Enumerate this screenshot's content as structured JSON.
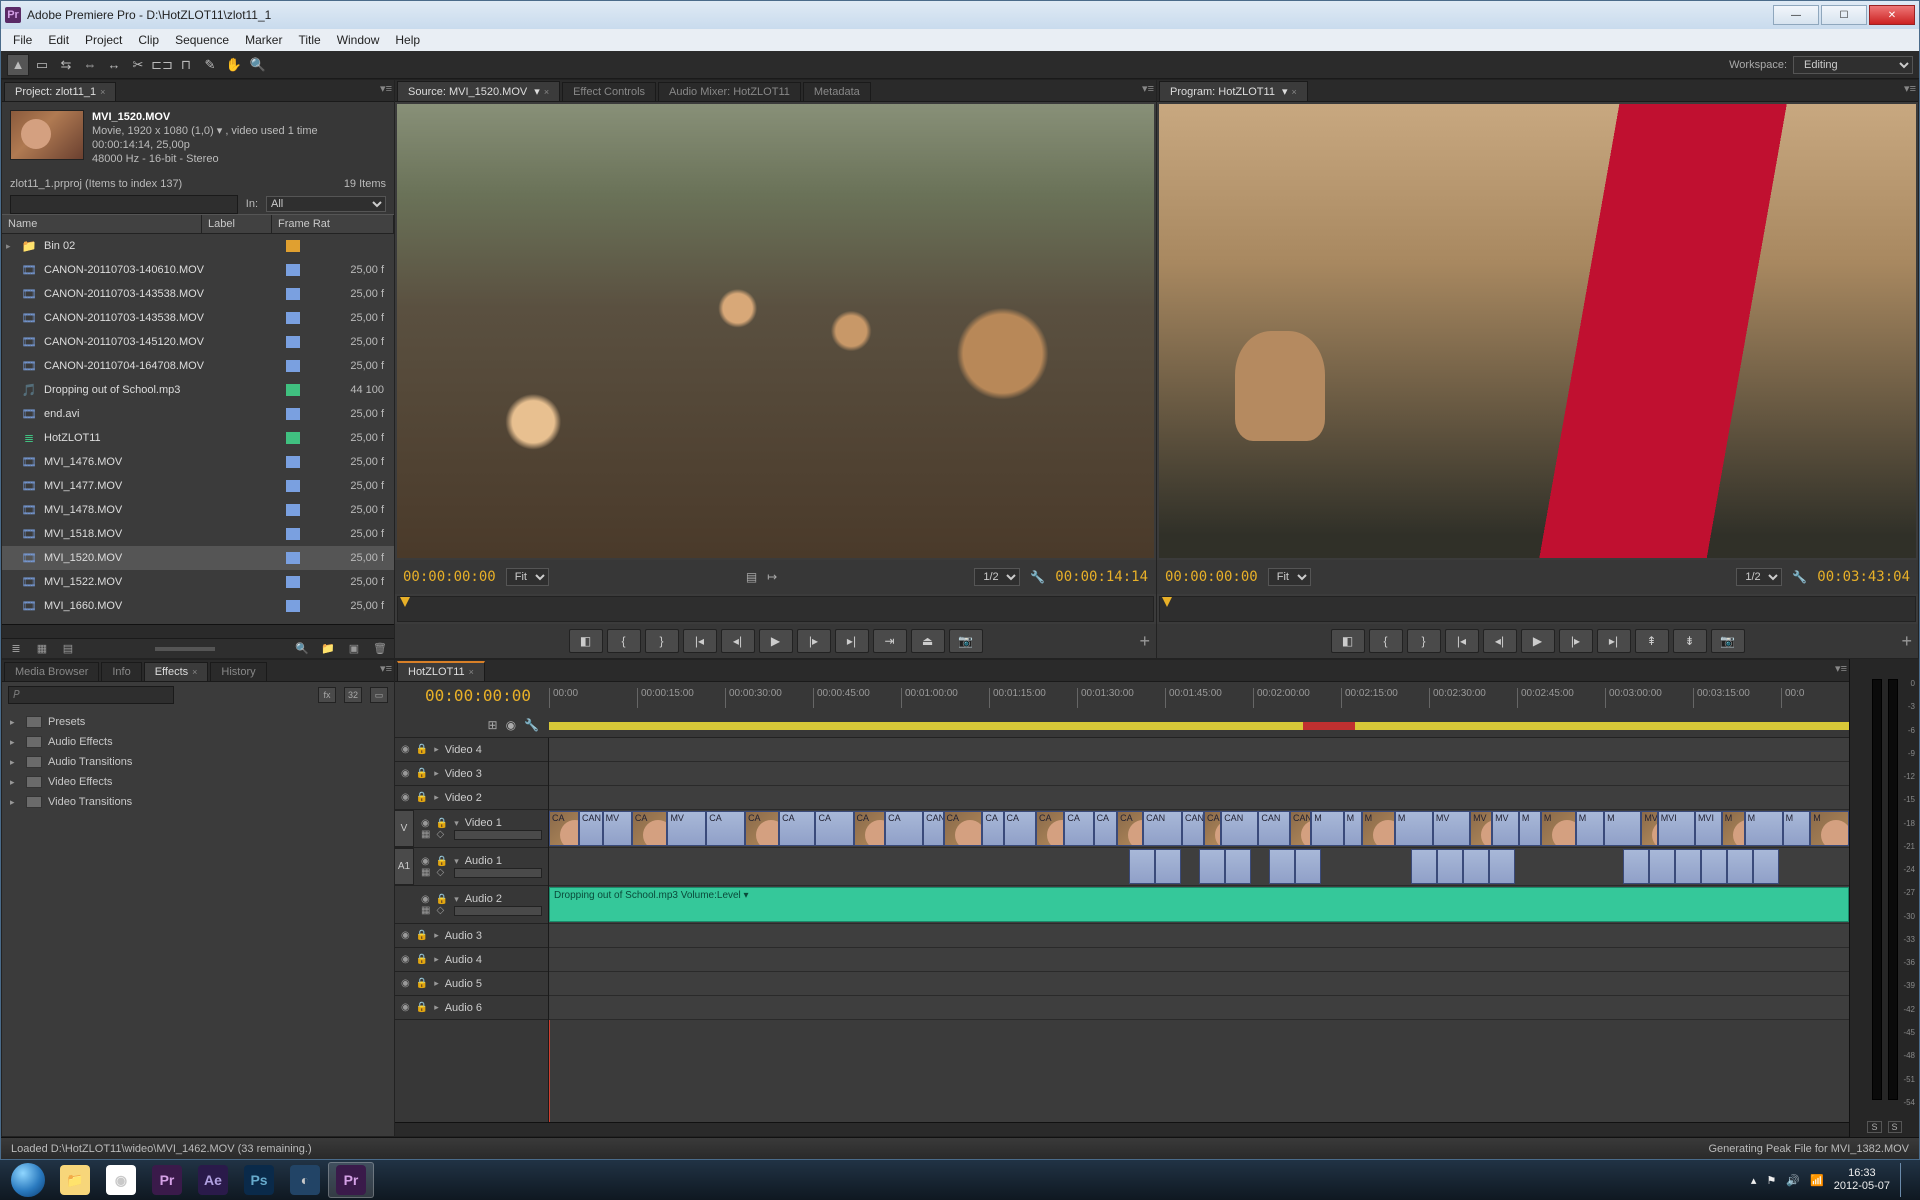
{
  "title": "Adobe Premiere Pro - D:\\HotZLOT11\\zlot11_1",
  "menus": [
    "File",
    "Edit",
    "Project",
    "Clip",
    "Sequence",
    "Marker",
    "Title",
    "Window",
    "Help"
  ],
  "workspace": {
    "label": "Workspace:",
    "value": "Editing"
  },
  "project": {
    "tab": "Project: zlot11_1",
    "clipName": "MVI_1520.MOV",
    "clipMeta1": "Movie, 1920 x 1080 (1,0) ▾ , video used 1 time",
    "clipMeta2": "00:00:14:14, 25,00p",
    "clipMeta3": "48000 Hz - 16-bit - Stereo",
    "path": "zlot11_1.prproj  (Items to index 137)",
    "count": "19 Items",
    "inLabel": "In:",
    "inValue": "All",
    "cols": {
      "name": "Name",
      "label": "Label",
      "rate": "Frame Rat"
    },
    "items": [
      {
        "ico": "📁",
        "name": "Bin 02",
        "lbl": "#e0a030",
        "rate": ""
      },
      {
        "ico": "🎞",
        "name": "CANON-20110703-140610.MOV",
        "lbl": "#7aa0e0",
        "rate": "25,00 f"
      },
      {
        "ico": "🎞",
        "name": "CANON-20110703-143538.MOV",
        "lbl": "#7aa0e0",
        "rate": "25,00 f"
      },
      {
        "ico": "🎞",
        "name": "CANON-20110703-143538.MOV",
        "lbl": "#7aa0e0",
        "rate": "25,00 f"
      },
      {
        "ico": "🎞",
        "name": "CANON-20110703-145120.MOV",
        "lbl": "#7aa0e0",
        "rate": "25,00 f"
      },
      {
        "ico": "🎞",
        "name": "CANON-20110704-164708.MOV",
        "lbl": "#7aa0e0",
        "rate": "25,00 f"
      },
      {
        "ico": "🎵",
        "name": "Dropping out of School.mp3",
        "lbl": "#40c080",
        "rate": "44 100"
      },
      {
        "ico": "🎞",
        "name": "end.avi",
        "lbl": "#7aa0e0",
        "rate": "25,00 f"
      },
      {
        "ico": "≣",
        "name": "HotZLOT11",
        "lbl": "#40c080",
        "rate": "25,00 f"
      },
      {
        "ico": "🎞",
        "name": "MVI_1476.MOV",
        "lbl": "#7aa0e0",
        "rate": "25,00 f"
      },
      {
        "ico": "🎞",
        "name": "MVI_1477.MOV",
        "lbl": "#7aa0e0",
        "rate": "25,00 f"
      },
      {
        "ico": "🎞",
        "name": "MVI_1478.MOV",
        "lbl": "#7aa0e0",
        "rate": "25,00 f"
      },
      {
        "ico": "🎞",
        "name": "MVI_1518.MOV",
        "lbl": "#7aa0e0",
        "rate": "25,00 f"
      },
      {
        "ico": "🎞",
        "name": "MVI_1520.MOV",
        "lbl": "#7aa0e0",
        "rate": "25,00 f",
        "sel": true
      },
      {
        "ico": "🎞",
        "name": "MVI_1522.MOV",
        "lbl": "#7aa0e0",
        "rate": "25,00 f"
      },
      {
        "ico": "🎞",
        "name": "MVI_1660.MOV",
        "lbl": "#7aa0e0",
        "rate": "25,00 f"
      }
    ]
  },
  "source": {
    "tabs": [
      {
        "t": "Source: MVI_1520.MOV",
        "a": true
      },
      {
        "t": "Effect Controls"
      },
      {
        "t": "Audio Mixer: HotZLOT11"
      },
      {
        "t": "Metadata"
      }
    ],
    "tcLeft": "00:00:00:00",
    "fit": "Fit",
    "zoom": "1/2",
    "tcRight": "00:00:14:14"
  },
  "program": {
    "tab": "Program: HotZLOT11",
    "tcLeft": "00:00:00:00",
    "fit": "Fit",
    "zoom": "1/2",
    "tcRight": "00:03:43:04"
  },
  "lowerTabs": {
    "a": "Media Browser",
    "b": "Info",
    "c": "Effects",
    "d": "History"
  },
  "effectsTree": [
    "Presets",
    "Audio Effects",
    "Audio Transitions",
    "Video Effects",
    "Video Transitions"
  ],
  "timeline": {
    "tab": "HotZLOT11",
    "tc": "00:00:00:00",
    "ticks": [
      "00:00",
      "00:00:15:00",
      "00:00:30:00",
      "00:00:45:00",
      "00:01:00:00",
      "00:01:15:00",
      "00:01:30:00",
      "00:01:45:00",
      "00:02:00:00",
      "00:02:15:00",
      "00:02:30:00",
      "00:02:45:00",
      "00:03:00:00",
      "00:03:15:00",
      "00:0"
    ],
    "vtracks": [
      "Video 4",
      "Video 3",
      "Video 2",
      "Video 1"
    ],
    "atracks": [
      "Audio 1",
      "Audio 2",
      "Audio 3",
      "Audio 4",
      "Audio 5",
      "Audio 6"
    ],
    "musicClip": "Dropping out of School.mp3   Volume:Level ▾"
  },
  "meterTicks": [
    "0",
    "-3",
    "-6",
    "-9",
    "-12",
    "-15",
    "-18",
    "-21",
    "-24",
    "-27",
    "-30",
    "-33",
    "-36",
    "-39",
    "-42",
    "-45",
    "-48",
    "-51",
    "-54"
  ],
  "status": {
    "left": "Loaded D:\\HotZLOT11\\wideo\\MVI_1462.MOV (33 remaining.)",
    "right": "Generating Peak File for MVI_1382.MOV"
  },
  "tray": {
    "time": "16:33",
    "date": "2012-05-07"
  }
}
